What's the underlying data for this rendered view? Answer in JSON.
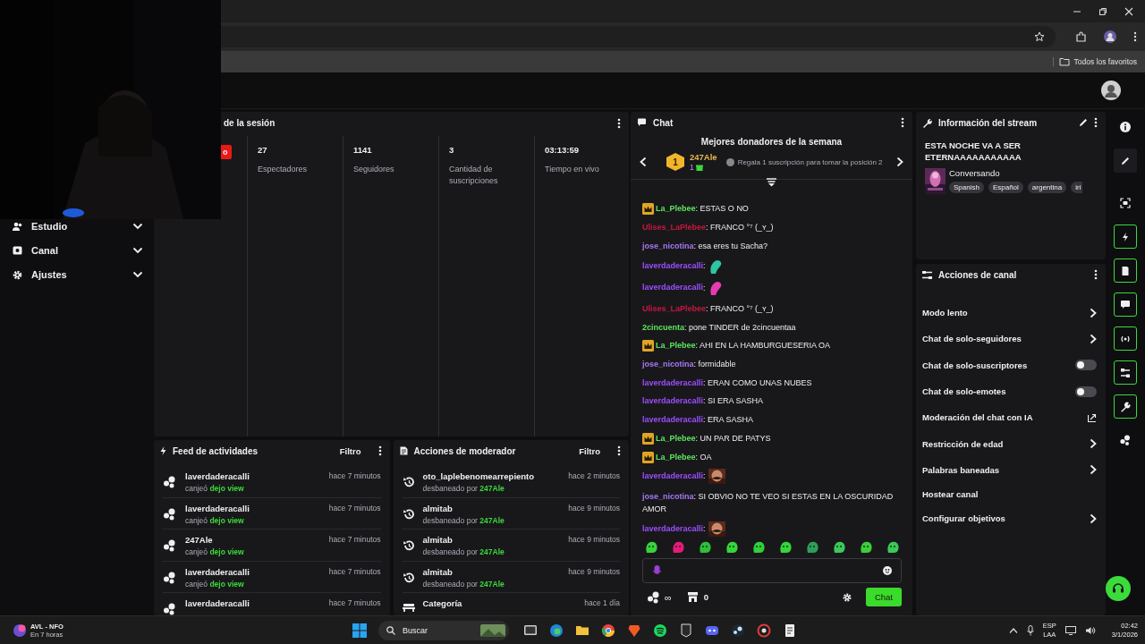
{
  "browser": {
    "bookmark": "Todos los favoritos"
  },
  "sidebar": {
    "items": [
      {
        "label": "Estudio",
        "kind": "people"
      },
      {
        "label": "Canal",
        "kind": "channel"
      },
      {
        "label": "Ajustes",
        "kind": "gear"
      }
    ]
  },
  "session": {
    "title": "de la sesión",
    "live_badge": "o",
    "stats": [
      {
        "value": "27",
        "label": "Espectadores"
      },
      {
        "value": "1141",
        "label": "Seguidores"
      },
      {
        "value": "3",
        "label": "Cantidad de suscripciones"
      },
      {
        "value": "03:13:59",
        "label": "Tiempo en vivo"
      }
    ]
  },
  "activity_feed": {
    "title": "Feed de actividades",
    "filter": "Filtro",
    "items": [
      {
        "user": "laverdaderacalli",
        "action": "canjeó",
        "reward": "dejo view",
        "time": "hace 7 minutos"
      },
      {
        "user": "laverdaderacalli",
        "action": "canjeó",
        "reward": "dejo view",
        "time": "hace 7 minutos"
      },
      {
        "user": "247Ale",
        "action": "canjeó",
        "reward": "dejo view",
        "time": "hace 7 minutos"
      },
      {
        "user": "laverdaderacalli",
        "action": "canjeó",
        "reward": "dejo view",
        "time": "hace 7 minutos"
      },
      {
        "user": "laverdaderacalli",
        "time": "hace 7 minutos"
      }
    ]
  },
  "mod_actions": {
    "title": "Acciones de moderador",
    "filter": "Filtro",
    "items": [
      {
        "kind": "unban",
        "user": "oto_laplebenomearrepiento",
        "action": "desbaneado por",
        "moderator": "247Ale",
        "time": "hace 2 minutos"
      },
      {
        "kind": "unban",
        "user": "almitab",
        "action": "desbaneado por",
        "moderator": "247Ale",
        "time": "hace 9 minutos"
      },
      {
        "kind": "unban",
        "user": "almitab",
        "action": "desbaneado por",
        "moderator": "247Ale",
        "time": "hace 9 minutos"
      },
      {
        "kind": "unban",
        "user": "almitab",
        "action": "desbaneado por",
        "moderator": "247Ale",
        "time": "hace 9 minutos"
      },
      {
        "kind": "category",
        "user": "Categoría",
        "time": "hace 1 día"
      }
    ]
  },
  "chat": {
    "title": "Chat",
    "donors": {
      "heading": "Mejores donadores de la semana",
      "rank": "1",
      "name": "247Ale",
      "count": "1",
      "hint": "Regala 1 suscripción para tomar la posición 2"
    },
    "messages": [
      {
        "user": "La_Plebee",
        "color": "#5ce65c",
        "badge": true,
        "text": ": ESTAS O NO"
      },
      {
        "user": "Ulises_LaPlebee",
        "color": "#c8173d",
        "badge": false,
        "text": ": FRANCO °⁷ (_ʏ_)"
      },
      {
        "user": "jose_nicotina",
        "color": "#a678f5",
        "badge": false,
        "text": ": esa eres tu Sacha?"
      },
      {
        "user": "laverdaderacalli",
        "color": "#9d4dff",
        "badge": false,
        "text": ":",
        "sticker": {
          "color": "#2fc4a2"
        }
      },
      {
        "user": "laverdaderacalli",
        "color": "#9d4dff",
        "badge": false,
        "text": ":",
        "sticker": {
          "color": "#e63bb0"
        }
      },
      {
        "user": "Ulises_LaPlebee",
        "color": "#c8173d",
        "badge": false,
        "text": ": FRANCO °⁷ (_ʏ_)"
      },
      {
        "user": "2cincuenta",
        "color": "#5ce65c",
        "badge": false,
        "text": ": pone TINDER de 2cincuentaa"
      },
      {
        "user": "La_Plebee",
        "color": "#5ce65c",
        "badge": true,
        "text": ": AHI EN LA HAMBURGUESERIA OA"
      },
      {
        "user": "jose_nicotina",
        "color": "#a678f5",
        "badge": false,
        "text": ": formidable"
      },
      {
        "user": "laverdaderacalli",
        "color": "#9d4dff",
        "badge": false,
        "text": ": ERAN COMO UNAS NUBES"
      },
      {
        "user": "laverdaderacalli",
        "color": "#9d4dff",
        "badge": false,
        "text": ": SI ERA SASHA"
      },
      {
        "user": "laverdaderacalli",
        "color": "#9d4dff",
        "badge": false,
        "text": ": ERA SASHA"
      },
      {
        "user": "La_Plebee",
        "color": "#5ce65c",
        "badge": true,
        "text": ": UN PAR DE PATYS"
      },
      {
        "user": "La_Plebee",
        "color": "#5ce65c",
        "badge": true,
        "text": ": OA"
      },
      {
        "user": "laverdaderacalli",
        "color": "#9d4dff",
        "badge": false,
        "text": ":"
      },
      {
        "user": "jose_nicotina",
        "color": "#a678f5",
        "badge": false,
        "text": ": SI OBVIO NO TE VEO SI ESTAS EN LA OSCURIDAD AMOR"
      },
      {
        "user": "laverdaderacalli",
        "color": "#9d4dff",
        "badge": false,
        "text": ":"
      }
    ],
    "emotes": [
      {
        "color": "#35d43a"
      },
      {
        "color": "#e8197a"
      },
      {
        "color": "#2fbf3a"
      },
      {
        "color": "#35d63a"
      },
      {
        "color": "#2fd13a"
      },
      {
        "color": "#35d63a"
      },
      {
        "color": "#2e9f5b"
      },
      {
        "color": "#3cc85a"
      },
      {
        "color": "#3ccf3a"
      },
      {
        "color": "#3bc95a"
      }
    ],
    "points": "∞",
    "store_count": "0",
    "send": "Chat"
  },
  "stream_info": {
    "title": "Información del stream",
    "stream_title": "ESTA NOCHE VA A SER ETERNAAAAAAAAAAA",
    "category": "Conversando",
    "tags": [
      "Spanish",
      "Español",
      "argentina",
      "iri"
    ]
  },
  "channel_actions": {
    "title": "Acciones de canal",
    "items": [
      {
        "label": "Modo lento",
        "kind": "chevron"
      },
      {
        "label": "Chat de solo-seguidores",
        "kind": "chevron"
      },
      {
        "label": "Chat de solo-suscriptores",
        "kind": "toggle",
        "on": false
      },
      {
        "label": "Chat de solo-emotes",
        "kind": "toggle",
        "on": false
      },
      {
        "label": "Moderación del chat con IA",
        "kind": "external"
      },
      {
        "label": "Restricción de edad",
        "kind": "chevron"
      },
      {
        "label": "Palabras baneadas",
        "kind": "chevron"
      },
      {
        "label": "Hostear canal",
        "kind": "plain"
      },
      {
        "label": "Configurar objetivos",
        "kind": "chevron"
      }
    ]
  },
  "taskbar": {
    "weather_title": "AVL - NFO",
    "weather_sub": "En 7 horas",
    "search": "Buscar",
    "lang": "ESP",
    "lang_sub": "LAA",
    "time": "02:42",
    "date": "3/1/2026"
  }
}
